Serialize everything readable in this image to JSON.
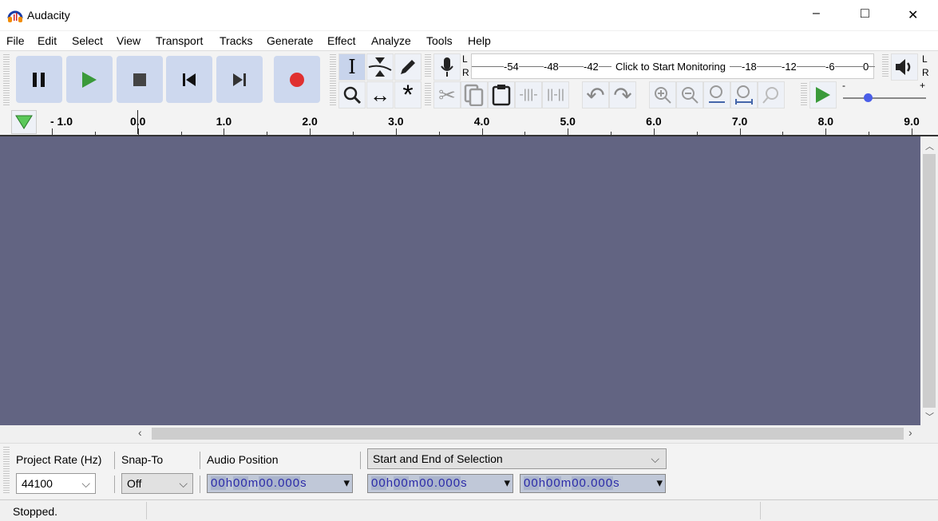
{
  "window": {
    "title": "Audacity",
    "minimize": "–",
    "maximize": "□",
    "close": "✕"
  },
  "menu": [
    "File",
    "Edit",
    "Select",
    "View",
    "Transport",
    "Tracks",
    "Generate",
    "Effect",
    "Analyze",
    "Tools",
    "Help"
  ],
  "meter": {
    "record_ticks": [
      "-54",
      "-48",
      "-42",
      "-18",
      "-12",
      "-6",
      "0"
    ],
    "monitor_label": "Click to Start Monitoring",
    "L": "L",
    "R": "R"
  },
  "playback_speed": {
    "minus": "-",
    "plus": "+",
    "level": 0.3
  },
  "ruler": {
    "ticks": [
      "- 1.0",
      "0.0",
      "1.0",
      "2.0",
      "3.0",
      "4.0",
      "5.0",
      "6.0",
      "7.0",
      "8.0",
      "9.0"
    ]
  },
  "selection_toolbar": {
    "project_rate_label": "Project Rate (Hz)",
    "project_rate": "44100",
    "snap_label": "Snap-To",
    "snap_value": "Off",
    "audio_position_label": "Audio Position",
    "selection_mode": "Start and End of Selection",
    "time_value": [
      "00",
      "h",
      "00",
      "m",
      "00.000",
      "s"
    ]
  },
  "status": {
    "text": "Stopped."
  },
  "colors": {
    "track_bg": "#626482",
    "button_bg": "#cdd8ee",
    "play": "#3a9a3a",
    "record": "#e03030"
  }
}
